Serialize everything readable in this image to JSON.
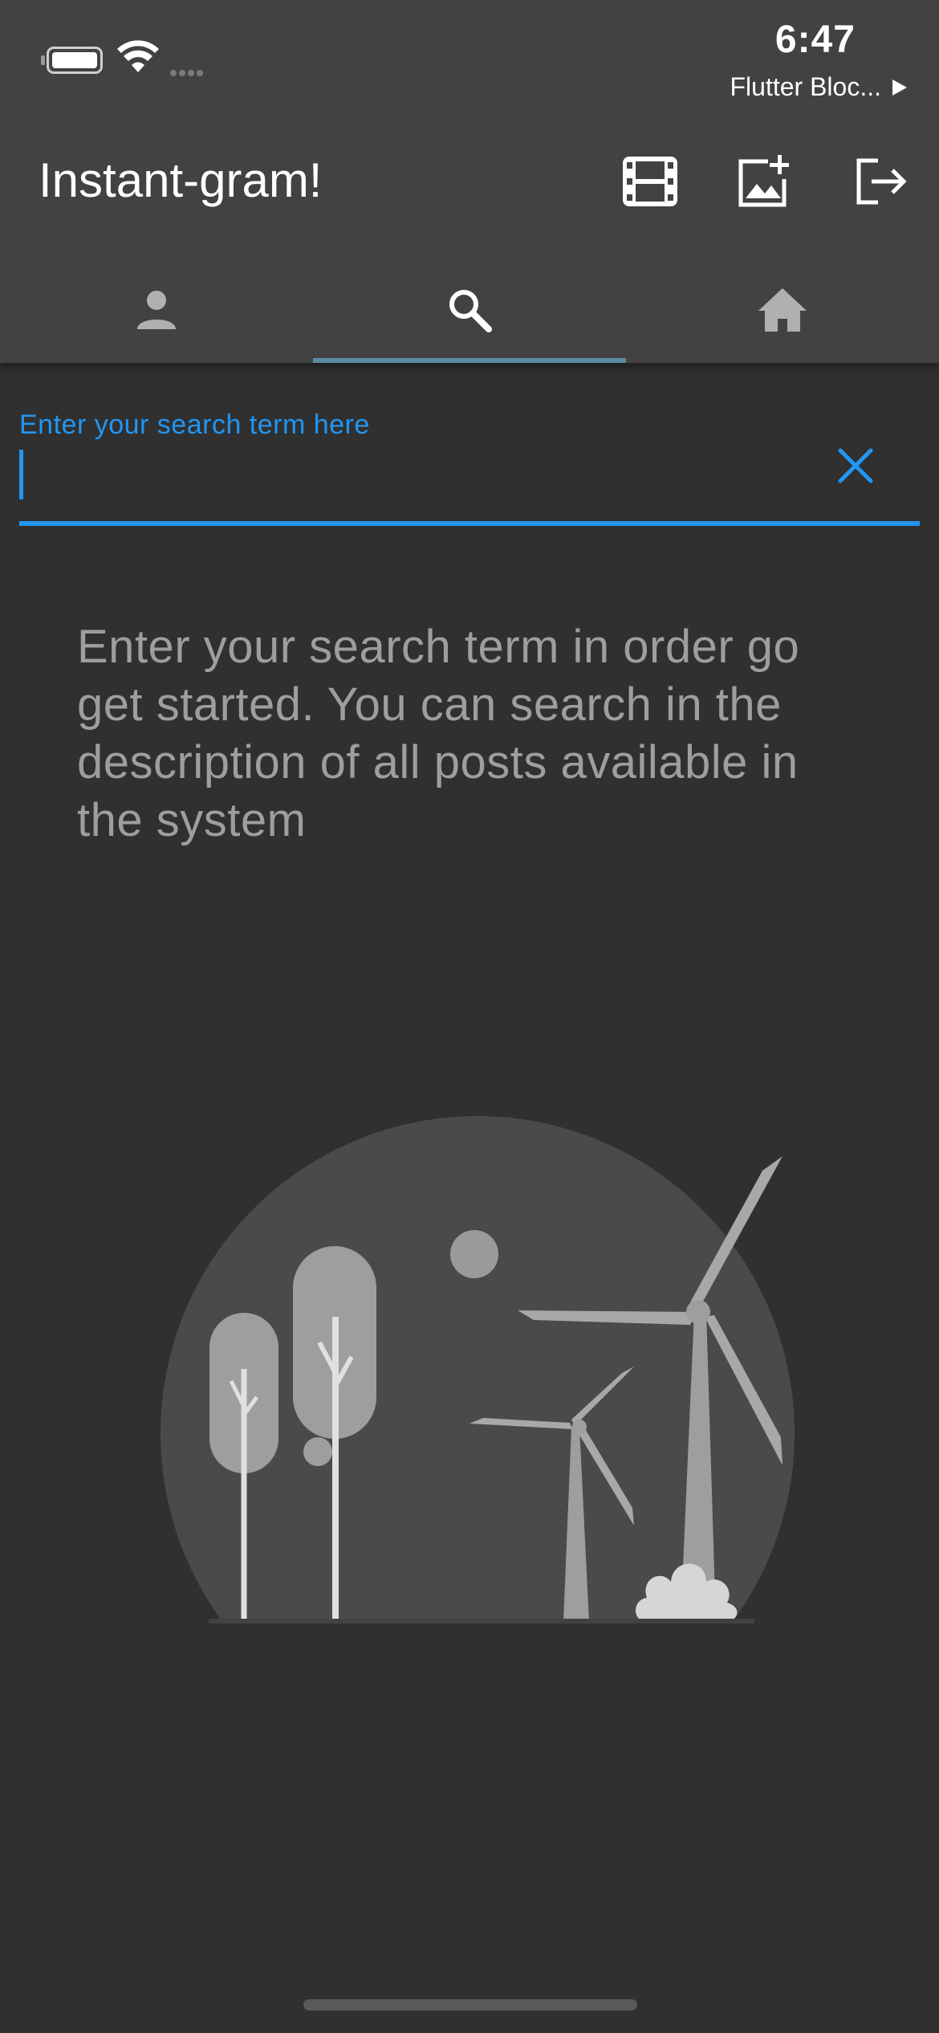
{
  "status_bar": {
    "time": "6:47",
    "carrier": "Flutter Bloc...",
    "icons": [
      "battery-icon",
      "wifi-icon",
      "cellular-signal-icon",
      "play-icon"
    ]
  },
  "app_bar": {
    "title": "Instant-gram!",
    "actions": [
      {
        "name": "film-icon",
        "label": "Videos"
      },
      {
        "name": "add-photo-icon",
        "label": "Add photo"
      },
      {
        "name": "logout-icon",
        "label": "Log out"
      }
    ]
  },
  "tabs": [
    {
      "icon": "person-icon",
      "label": "Profile",
      "selected": false
    },
    {
      "icon": "search-icon",
      "label": "Search",
      "selected": true
    },
    {
      "icon": "home-icon",
      "label": "Home",
      "selected": false
    }
  ],
  "search": {
    "label": "Enter your search term here",
    "value": "",
    "clear_icon": "close-icon"
  },
  "empty_state": {
    "message": "Enter your search term in order go get started. You can search in the description of all posts available in the system",
    "illustration": "wind-turbines-illustration"
  },
  "colors": {
    "accent": "#2196f3",
    "app_bar": "#424242",
    "background": "#303030",
    "tab_indicator": "#5b8aa4",
    "muted_text": "#9e9e9e"
  }
}
